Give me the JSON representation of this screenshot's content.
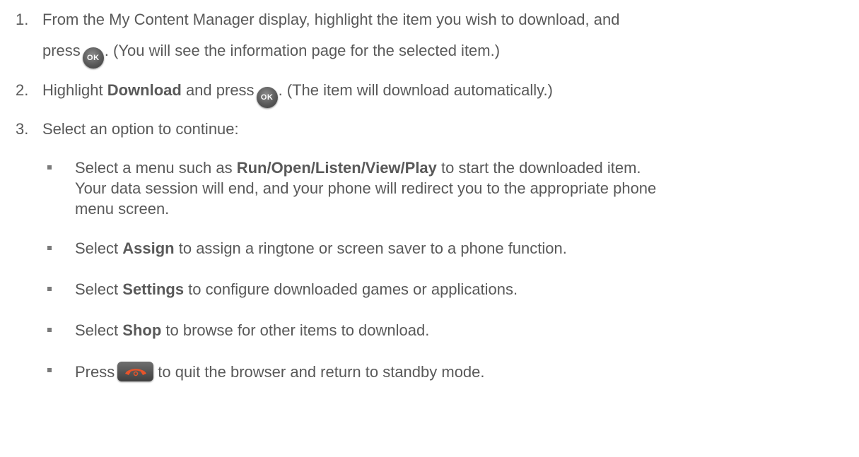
{
  "steps": [
    {
      "num": "1.",
      "line1": "From the My Content Manager display, highlight the item you wish to download, and",
      "line2_pre": "press",
      "line2_post": ". (You will see the information page for the selected item.)"
    },
    {
      "num": "2.",
      "pre": "Highlight ",
      "bold": "Download",
      "mid": " and press",
      "post": ". (The item will download automatically.)"
    },
    {
      "num": "3.",
      "text": "Select an option to continue:"
    }
  ],
  "options": [
    {
      "pre": "Select a menu such as ",
      "bold": "Run/Open/Listen/View/Play",
      "post": " to start the downloaded item.",
      "line2": "Your data session will end, and your phone will redirect you to the appropriate phone",
      "line3": "menu screen."
    },
    {
      "pre": "Select ",
      "bold": "Assign",
      "post": " to assign a ringtone or screen saver to a phone function."
    },
    {
      "pre": "Select ",
      "bold": "Settings",
      "post": " to configure downloaded games or applications."
    },
    {
      "pre": "Select ",
      "bold": "Shop",
      "post": " to browse for other items to download."
    },
    {
      "pre": "Press",
      "post": "to quit the browser and return to standby mode."
    }
  ],
  "keys": {
    "ok_label": "OK",
    "ok_icon": "ok-key-icon",
    "end_icon": "end-call-key-icon",
    "end_color": "#e8542a"
  }
}
